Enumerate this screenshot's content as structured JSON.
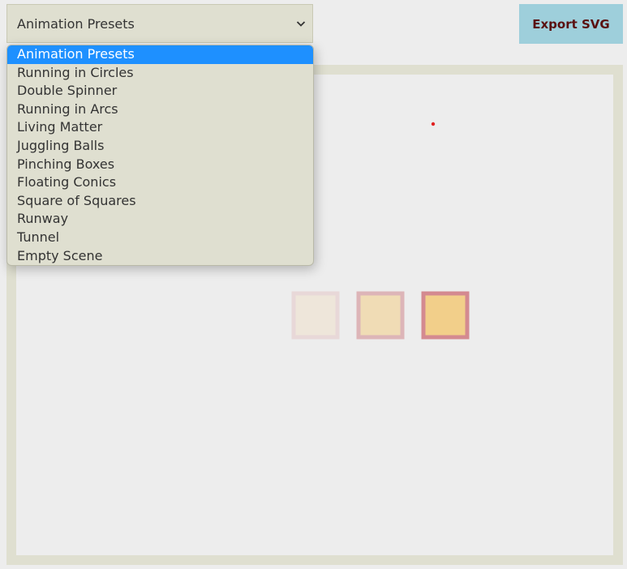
{
  "toolbar": {
    "preset_select": {
      "value": "Animation Presets",
      "options": [
        "Animation Presets",
        "Running in Circles",
        "Double Spinner",
        "Running in Arcs",
        "Living Matter",
        "Juggling Balls",
        "Pinching Boxes",
        "Floating Conics",
        "Square of Squares",
        "Runway",
        "Tunnel",
        "Empty Scene"
      ],
      "highlighted_index": 0
    },
    "export_label": "Export SVG"
  },
  "scene": {
    "dot_color": "#e02020",
    "boxes": [
      {
        "stroke": "#e8d8d8",
        "fill": "#eee6da"
      },
      {
        "stroke": "#ddb5b8",
        "fill": "#f0dcb5"
      },
      {
        "stroke": "#d48a90",
        "fill": "#f2cf8a"
      }
    ]
  },
  "colors": {
    "frame": "#dfdfd0",
    "stage": "#ededed",
    "accent": "#1e90ff",
    "export_bg": "#9ecfdb"
  }
}
